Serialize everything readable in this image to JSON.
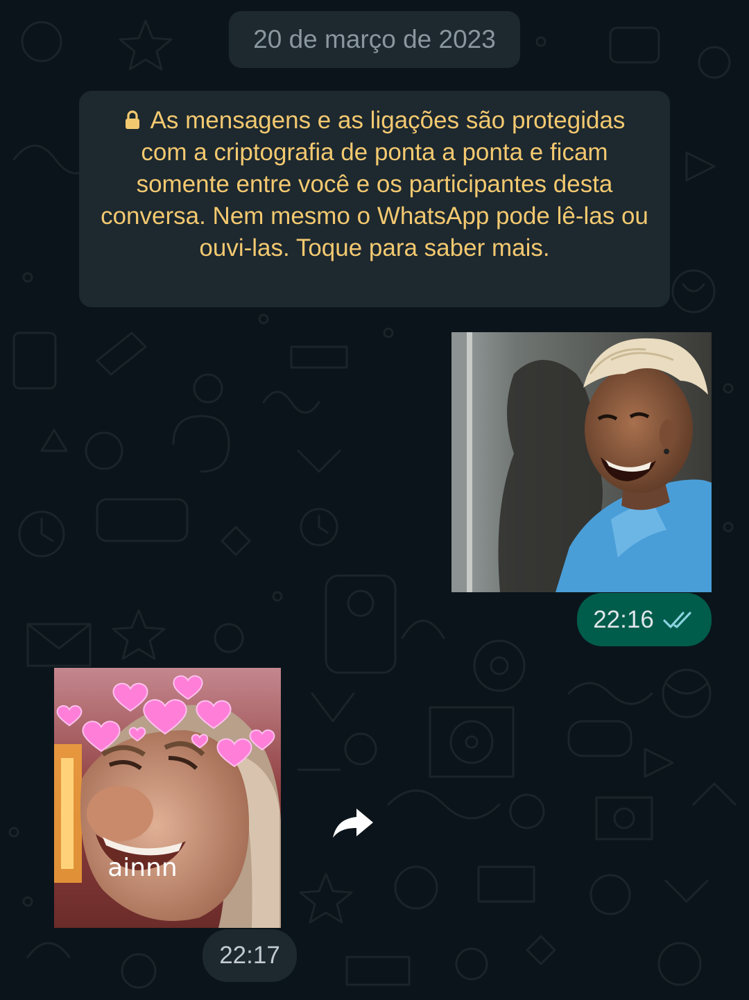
{
  "chat": {
    "date_chip": "20 de março de 2023",
    "encryption_notice": "As mensagens e as ligações são protegidas com a criptografia de ponta a ponta e ficam somente entre você e os participantes desta conversa. Nem mesmo o WhatsApp pode lê-las ou ouvi-las. Toque para saber mais.",
    "messages": [
      {
        "direction": "outgoing",
        "type": "sticker",
        "sticker_subject": "smiling man with bleached hair in blue shirt",
        "time": "22:16",
        "status": "read"
      },
      {
        "direction": "incoming",
        "type": "sticker",
        "sticker_subject": "woman squinting with heart crown",
        "sticker_caption": "ainnn",
        "time": "22:17"
      }
    ]
  },
  "colors": {
    "background": "#0b141a",
    "system_bubble": "#1d282f",
    "notice_text": "#f3c970",
    "outgoing_bubble": "#005c4b",
    "read_ticks": "#8ad2e0"
  },
  "icons": {
    "lock": "lock-icon",
    "read_ticks": "double-check-icon",
    "forward": "forward-icon"
  }
}
